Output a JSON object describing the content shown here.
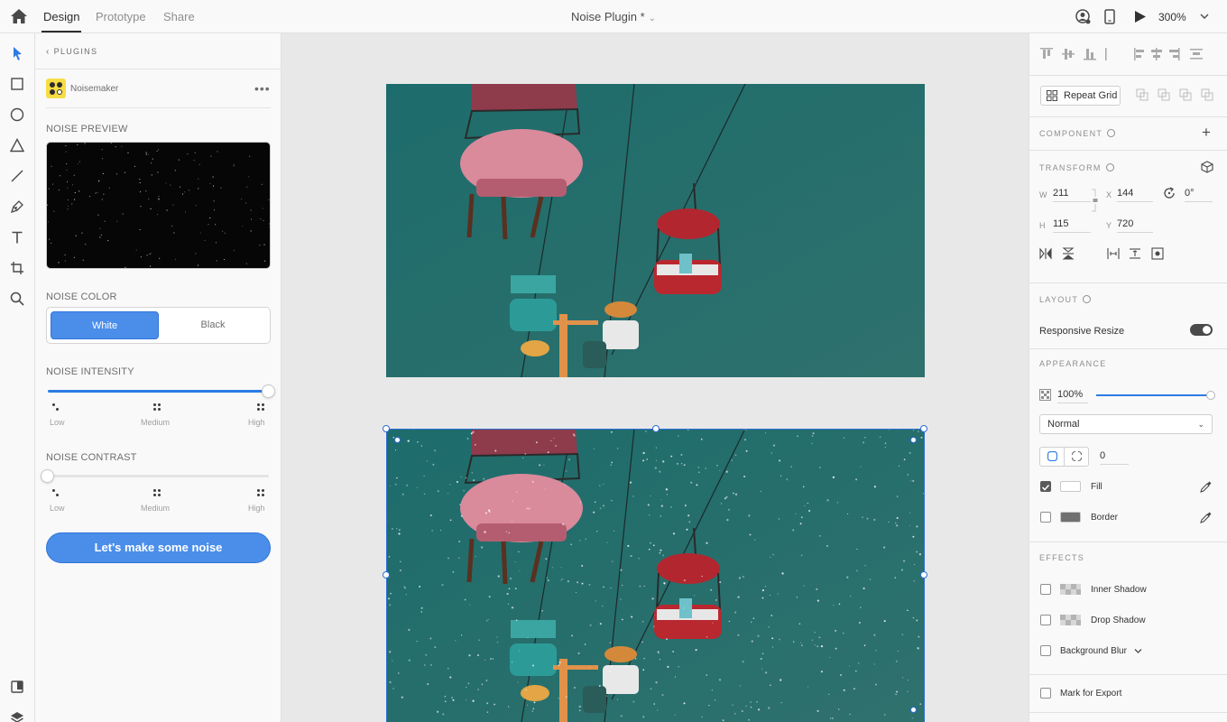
{
  "topbar": {
    "tabs": [
      "Design",
      "Prototype",
      "Share"
    ],
    "doc_title": "Noise Plugin *",
    "zoom": "300%"
  },
  "tools": [
    "select-icon",
    "rectangle-icon",
    "ellipse-icon",
    "triangle-icon",
    "line-icon",
    "pen-icon",
    "text-icon",
    "artboard-icon",
    "zoom-icon",
    "assets-icon",
    "layers-icon"
  ],
  "plugin": {
    "back_label": "PLUGINS",
    "name": "Noisemaker",
    "more": "•••",
    "preview_label": "NOISE PREVIEW",
    "color_label": "NOISE COLOR",
    "color_options": [
      "White",
      "Black"
    ],
    "color_selected": "White",
    "intensity_label": "NOISE INTENSITY",
    "intensity_value": 1.0,
    "contrast_label": "NOISE CONTRAST",
    "contrast_value": 0.0,
    "scale_labels": [
      "Low",
      "Medium",
      "High"
    ],
    "cta_label": "Let's make some noise"
  },
  "inspector": {
    "repeat_grid": "Repeat Grid",
    "component_label": "COMPONENT",
    "transform_label": "TRANSFORM",
    "w_label": "W",
    "w_value": "211",
    "x_label": "X",
    "x_value": "144",
    "rotation_value": "0°",
    "h_label": "H",
    "h_value": "115",
    "y_label": "Y",
    "y_value": "720",
    "layout_label": "LAYOUT",
    "responsive_resize": "Responsive Resize",
    "responsive_on": true,
    "appearance_label": "APPEARANCE",
    "opacity": "100%",
    "blend_mode": "Normal",
    "corner_radius": "0",
    "fill_label": "Fill",
    "fill_checked": true,
    "fill_color": "#ffffff",
    "border_label": "Border",
    "border_checked": false,
    "border_color": "#707070",
    "effects_label": "EFFECTS",
    "inner_shadow": "Inner Shadow",
    "drop_shadow": "Drop Shadow",
    "background_blur": "Background Blur",
    "mark_export": "Mark for Export"
  },
  "colors": {
    "accent": "#4b8eea",
    "selection": "#2c6fd3",
    "sky": "#1e6e6a"
  }
}
